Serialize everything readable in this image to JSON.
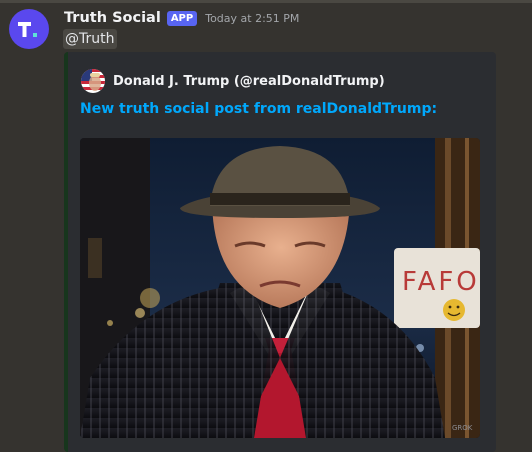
{
  "message": {
    "author": "Truth Social",
    "badge": "APP",
    "timestamp": "Today at 2:51 PM",
    "mention": "@Truth"
  },
  "embed": {
    "author_name": "Donald J. Trump (@realDonaldTrump)",
    "title": "New truth social post from realDonaldTrump:",
    "image_sign_text": "FAFO",
    "accent_color": "#17361d",
    "title_color": "#00a8fc"
  },
  "colors": {
    "background": "#35332f",
    "avatar": "#5a48ee",
    "badge": "#5865f2",
    "embed_bg": "#2b2d31"
  },
  "icons": {
    "avatar": "truth-social-logo-icon",
    "embed_author": "us-flag-avatar-icon"
  }
}
